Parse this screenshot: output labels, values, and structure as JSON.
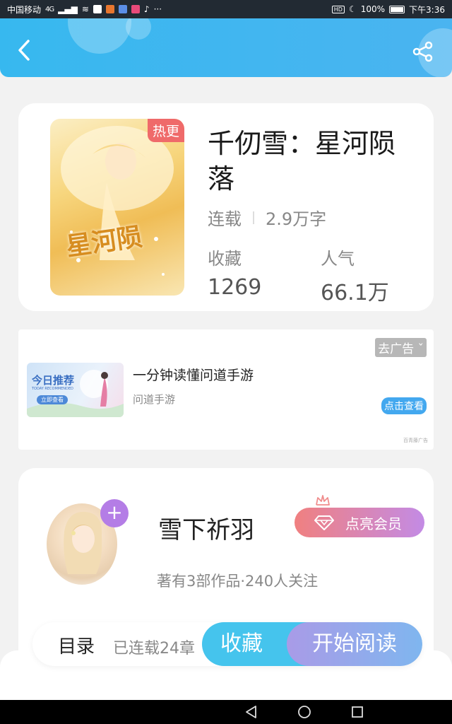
{
  "status_bar": {
    "carrier": "中国移动",
    "network": "4G",
    "battery": "100%",
    "time": "下午3:36",
    "hd": "HD"
  },
  "header": {
    "back_icon": "chevron-left-icon",
    "share_icon": "share-icon"
  },
  "book": {
    "tag": "热更",
    "cover_art_text": "星河陨",
    "title": "千仞雪：星河陨落",
    "status": "连载",
    "word_count": "2.9万字",
    "stats": [
      {
        "label": "收藏",
        "value": "1269"
      },
      {
        "label": "人气",
        "value": "66.1万"
      }
    ]
  },
  "ad": {
    "close_label": "去广告",
    "image_title": "今日推荐",
    "image_subtitle": "TODAY RECOMMENDED",
    "image_button": "立即查看",
    "title": "一分钟读懂问道手游",
    "source": "问道手游",
    "cta_label": "点击查看",
    "provider": "百青藤广告"
  },
  "author": {
    "name": "雪下祈羽",
    "follow_label": "+",
    "vip_label": "点亮会员",
    "info": "著有3部作品·240人关注"
  },
  "action_bar": {
    "toc_label": "目录",
    "toc_count": "已连载24章",
    "favorite_label": "收藏",
    "read_label": "开始阅读"
  },
  "nav_bar": {
    "back_icon": "triangle-back-icon",
    "home_icon": "circle-home-icon",
    "recents_icon": "square-recents-icon"
  },
  "colors": {
    "header_blue": "#37b8ef",
    "tag_red": "#ef6a6a",
    "follow_purple": "#b47de6",
    "favorite_blue": "#45c4ed"
  }
}
